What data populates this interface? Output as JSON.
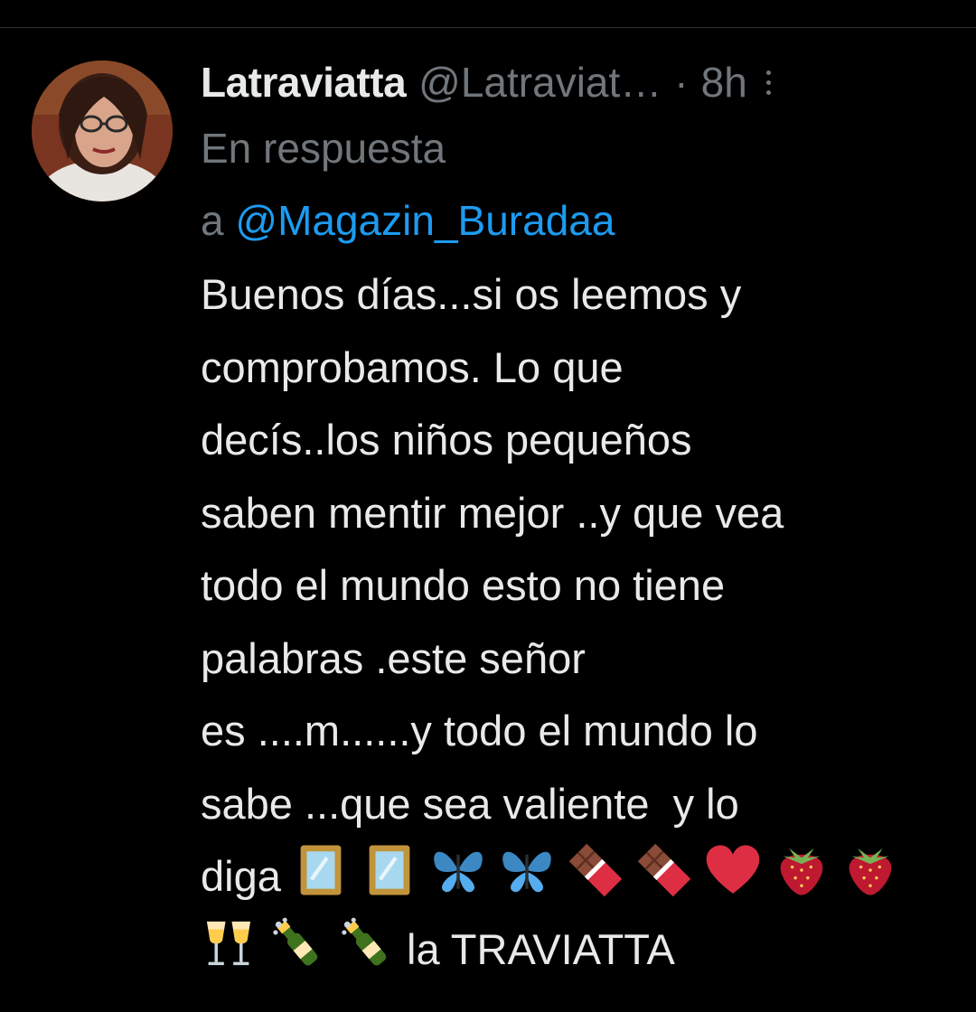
{
  "tweet": {
    "author_name": "Latraviatta",
    "author_handle": "@Latraviat…",
    "separator": "·",
    "timestamp": "8h",
    "reply_prefix": "En respuesta",
    "reply_to_prefix": "a",
    "reply_to_handle": "@Magazin_Buradaa",
    "text_lines": [
      "Buenos días...si os leemos y",
      "comprobamos. Lo que",
      "decís..los niños pequeños",
      "saben mentir mejor ..y que vea",
      "todo el mundo esto no tiene",
      "palabras .este señor",
      "es ....m......y todo el mundo lo",
      "sabe ...que sea valiente  y lo"
    ],
    "line_9_text": "diga",
    "line_9_emojis": [
      "mirror-icon",
      "mirror-icon",
      "butterfly-icon",
      "butterfly-icon",
      "chocolate-bar-icon",
      "chocolate-bar-icon",
      "red-heart-icon",
      "strawberry-icon",
      "strawberry-icon"
    ],
    "line_10_emojis": [
      "clinking-glasses-icon",
      "champagne-bottle-icon",
      "champagne-bottle-icon"
    ],
    "line_10_text": "la TRAVIATTA"
  },
  "colors": {
    "background": "#000000",
    "text_primary": "#e7e9ea",
    "text_secondary": "#71767b",
    "link": "#1d9bf0"
  }
}
